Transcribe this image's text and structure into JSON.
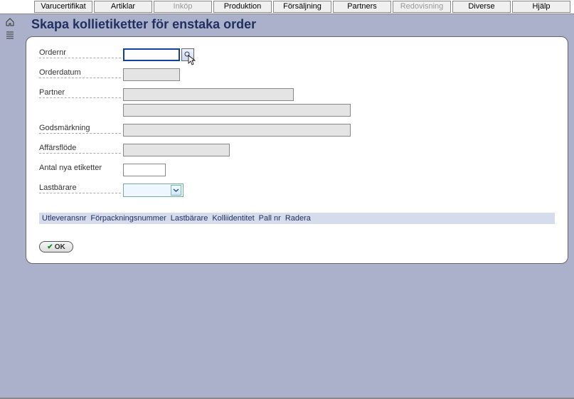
{
  "tabs": [
    {
      "label": "Varucertifikat",
      "enabled": true
    },
    {
      "label": "Artiklar",
      "enabled": true
    },
    {
      "label": "Inköp",
      "enabled": false
    },
    {
      "label": "Produktion",
      "enabled": true
    },
    {
      "label": "Försäljning",
      "enabled": true
    },
    {
      "label": "Partners",
      "enabled": true
    },
    {
      "label": "Redovisning",
      "enabled": false
    },
    {
      "label": "Diverse",
      "enabled": true
    },
    {
      "label": "Hjälp",
      "enabled": true
    }
  ],
  "page": {
    "title": "Skapa kollietiketter för enstaka order"
  },
  "form": {
    "ordernr": {
      "label": "Ordernr",
      "value": ""
    },
    "orderdatum": {
      "label": "Orderdatum",
      "value": ""
    },
    "partner": {
      "label": "Partner",
      "value1": "",
      "value2": ""
    },
    "godsmarkning": {
      "label": "Godsmärkning",
      "value": ""
    },
    "affarsflode": {
      "label": "Affärsflöde",
      "value": ""
    },
    "antal": {
      "label": "Antal nya etiketter",
      "value": ""
    },
    "lastbarare": {
      "label": "Lastbärare",
      "selected": ""
    }
  },
  "table_headers": [
    "Utleveransnr",
    "Förpackningsnummer",
    "Lastbärare",
    "Kolliidentitet",
    "Pall nr",
    "Radera"
  ],
  "buttons": {
    "ok": "OK"
  }
}
